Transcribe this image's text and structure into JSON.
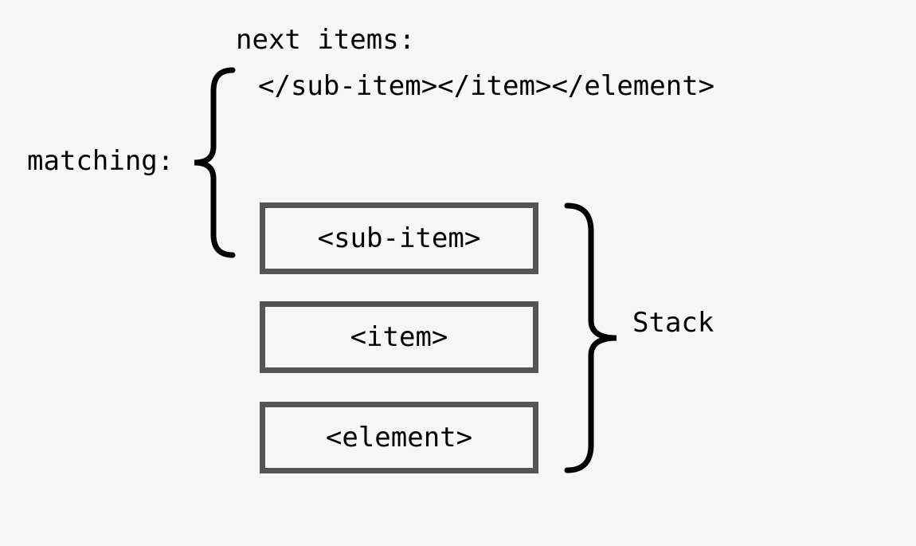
{
  "labels": {
    "next_items": "next items:",
    "matching": "matching:",
    "stack": "Stack"
  },
  "closing_tags": "</sub-item></item></element>",
  "stack_items": [
    "<sub-item>",
    "<item>",
    "<element>"
  ]
}
